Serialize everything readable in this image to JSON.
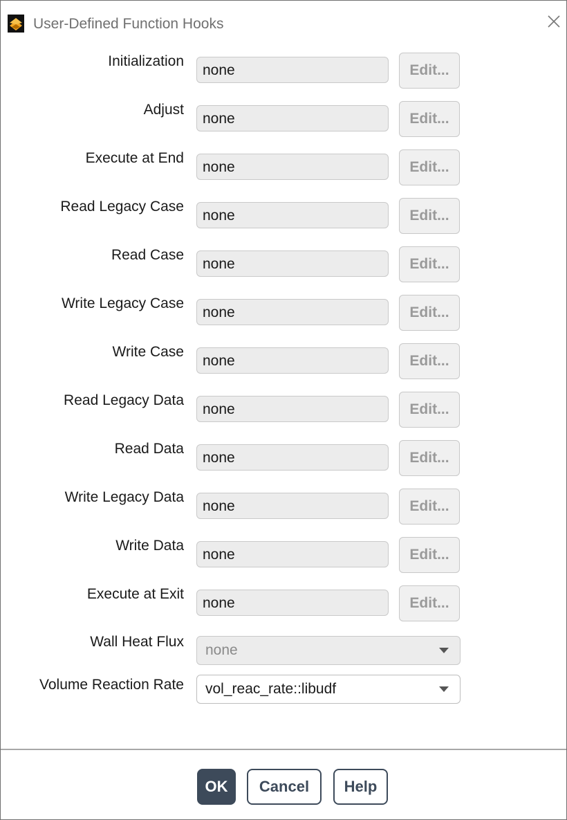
{
  "window": {
    "title": "User-Defined Function Hooks",
    "app_icon": "ansys-fluent-icon",
    "close_icon": "close-icon"
  },
  "hooks": [
    {
      "label": "Initialization",
      "value": "none",
      "edit_label": "Edit..."
    },
    {
      "label": "Adjust",
      "value": "none",
      "edit_label": "Edit..."
    },
    {
      "label": "Execute at End",
      "value": "none",
      "edit_label": "Edit..."
    },
    {
      "label": "Read Legacy Case",
      "value": "none",
      "edit_label": "Edit..."
    },
    {
      "label": "Read Case",
      "value": "none",
      "edit_label": "Edit..."
    },
    {
      "label": "Write Legacy Case",
      "value": "none",
      "edit_label": "Edit..."
    },
    {
      "label": "Write Case",
      "value": "none",
      "edit_label": "Edit..."
    },
    {
      "label": "Read Legacy Data",
      "value": "none",
      "edit_label": "Edit..."
    },
    {
      "label": "Read Data",
      "value": "none",
      "edit_label": "Edit..."
    },
    {
      "label": "Write Legacy Data",
      "value": "none",
      "edit_label": "Edit..."
    },
    {
      "label": "Write Data",
      "value": "none",
      "edit_label": "Edit..."
    },
    {
      "label": "Execute at Exit",
      "value": "none",
      "edit_label": "Edit..."
    }
  ],
  "wall_heat_flux": {
    "label": "Wall Heat Flux",
    "selected": "none",
    "enabled": false
  },
  "volume_reaction_rate": {
    "label": "Volume Reaction Rate",
    "selected": "vol_reac_rate::libudf",
    "enabled": true
  },
  "buttons": {
    "ok": "OK",
    "cancel": "Cancel",
    "help": "Help"
  },
  "colors": {
    "primary_button": "#3d4a5a",
    "disabled_text": "#9a9a9a"
  }
}
